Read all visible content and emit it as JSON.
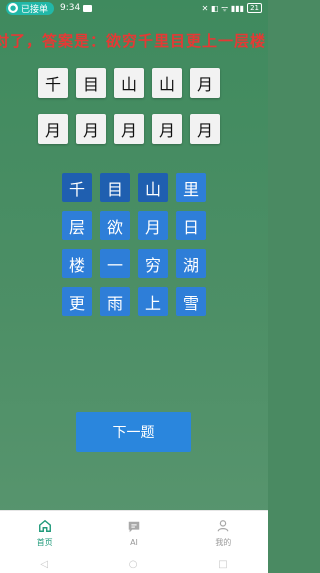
{
  "status_bar": {
    "app_pill": "已接单",
    "time": "9:34",
    "right_icons": "✕ ◧ ᯤ ▮▮▮",
    "battery": "21"
  },
  "result_text": "对了，答案是：欲穷千里目更上一层楼",
  "answer_rows": [
    [
      "千",
      "目",
      "山",
      "山",
      "月"
    ],
    [
      "月",
      "月",
      "月",
      "月",
      "月"
    ]
  ],
  "choices": [
    {
      "char": "千",
      "used": true
    },
    {
      "char": "目",
      "used": true
    },
    {
      "char": "山",
      "used": true
    },
    {
      "char": "里",
      "used": false
    },
    {
      "char": "层",
      "used": false
    },
    {
      "char": "欲",
      "used": false
    },
    {
      "char": "月",
      "used": false
    },
    {
      "char": "日",
      "used": false
    },
    {
      "char": "楼",
      "used": false
    },
    {
      "char": "一",
      "used": false
    },
    {
      "char": "穷",
      "used": false
    },
    {
      "char": "湖",
      "used": false
    },
    {
      "char": "更",
      "used": false
    },
    {
      "char": "雨",
      "used": false
    },
    {
      "char": "上",
      "used": false
    },
    {
      "char": "雪",
      "used": false
    }
  ],
  "next_button": "下一题",
  "bottom_nav": [
    {
      "label": "首页",
      "icon": "home-icon",
      "active": true
    },
    {
      "label": "AI",
      "icon": "chat-icon",
      "active": false
    },
    {
      "label": "我的",
      "icon": "user-icon",
      "active": false
    }
  ],
  "sys_nav": [
    "◁",
    "○",
    "□"
  ],
  "colors": {
    "background": "#4a8a62",
    "result_red": "#e53935",
    "choice_blue": "#2e7ed8",
    "button_blue": "#2a86dd",
    "nav_active": "#1f9a7a"
  }
}
